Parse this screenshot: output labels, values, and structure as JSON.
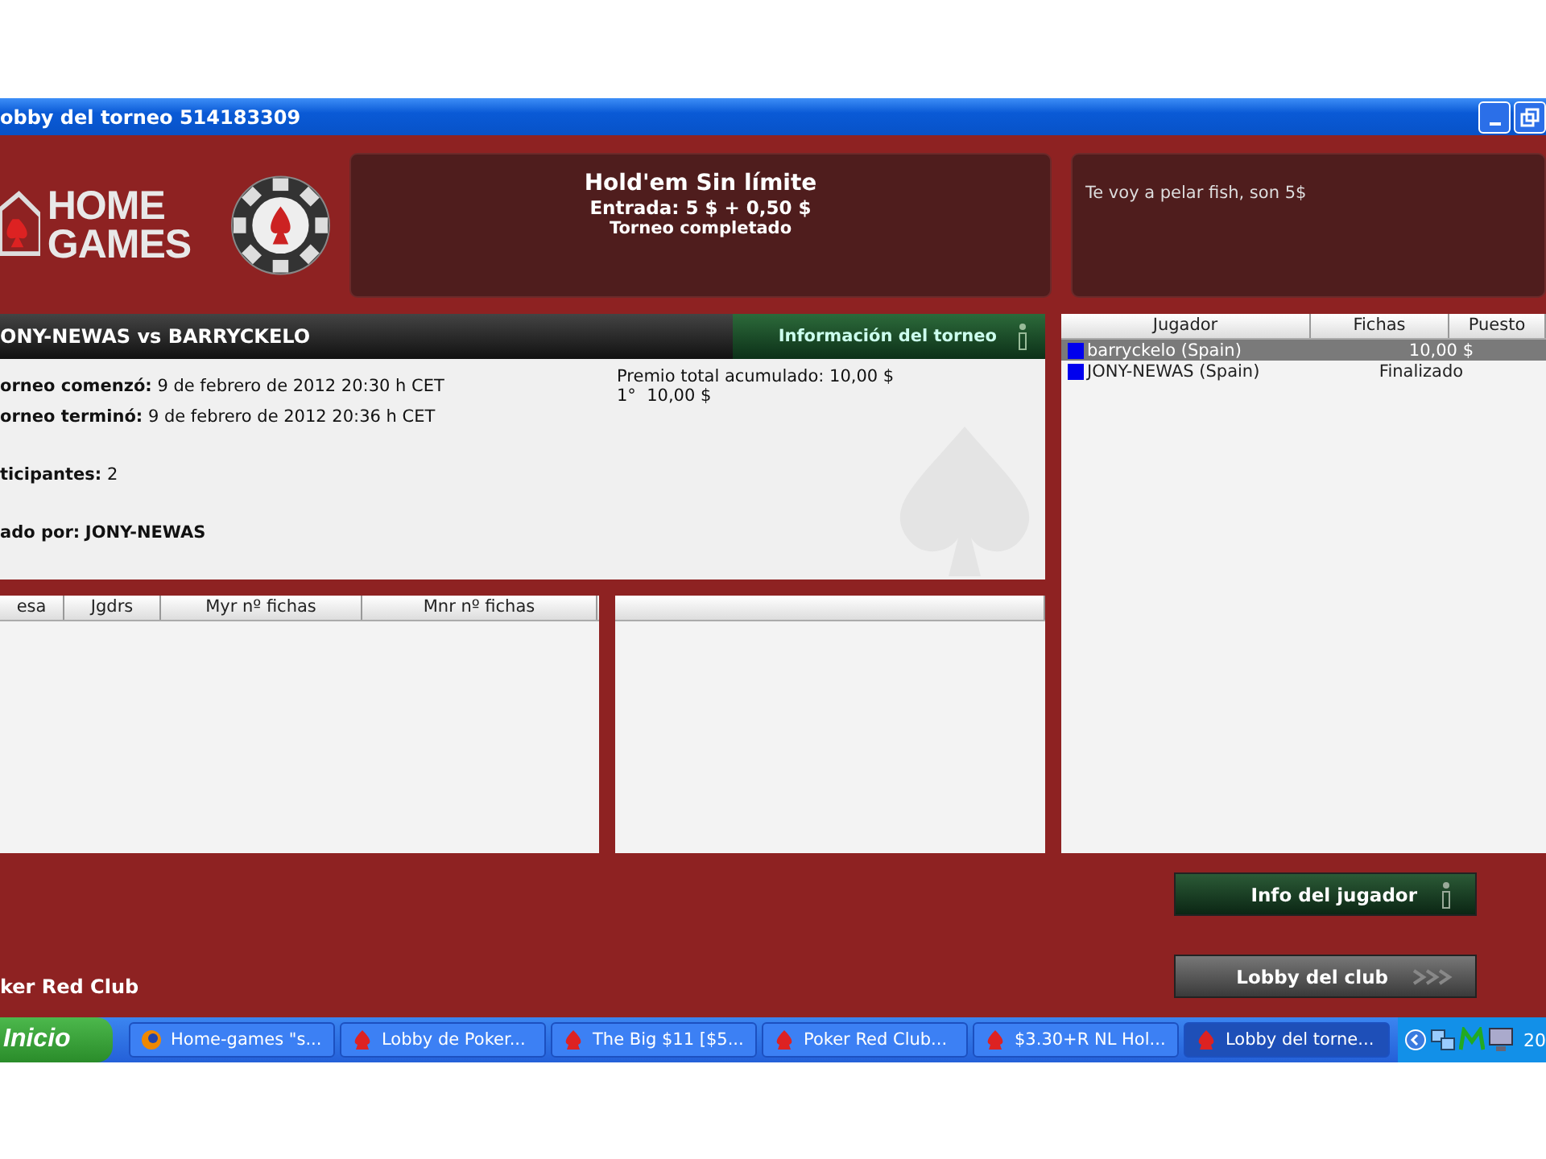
{
  "window": {
    "title": "obby del torneo 514183309"
  },
  "logo": {
    "line_1": "HOME",
    "line_2": "GAMES"
  },
  "game": {
    "name": "Hold'em Sin límite",
    "buyin": "Entrada: 5 $ + 0,50 $",
    "status": "Torneo completado"
  },
  "chat": {
    "message": "Te voy a pelar fish, son 5$"
  },
  "match": {
    "title": "ONY-NEWAS vs BARRYCKELO",
    "info_tab": "Información del torneo"
  },
  "details": [
    {
      "kind": "time",
      "label": "orneo comenzó:",
      "value": "9 de febrero de 2012 20:30 h CET"
    },
    {
      "kind": "time",
      "label": "orneo terminó:",
      "value": "9 de febrero de 2012 20:36 h CET"
    },
    {
      "kind": "count",
      "label": "ticipantes:",
      "value": "2"
    },
    {
      "kind": "host",
      "label": "ado por:",
      "value": "JONY-NEWAS"
    }
  ],
  "prize": {
    "total": "Premio total acumulado: 10,00 $",
    "places": [
      {
        "place": "1°",
        "amount": "10,00 $"
      }
    ]
  },
  "tables": {
    "columns": [
      "esa",
      "Jgdrs",
      "Myr nº fichas",
      "Mnr nº fichas"
    ]
  },
  "players": {
    "columns": [
      "Jugador",
      "Fichas",
      "Puesto"
    ],
    "rows": [
      {
        "name": "barryckelo (Spain)",
        "chips": "10,00 $",
        "selected": true,
        "color": "#0000ee"
      },
      {
        "name": "JONY-NEWAS (Spain)",
        "chips": "Finalizado",
        "selected": false,
        "color": "#0000ee"
      }
    ]
  },
  "club": {
    "name": "ker Red Club"
  },
  "buttons": [
    {
      "kind": "info",
      "label": "Info del jugador"
    },
    {
      "kind": "lobby",
      "label": "Lobby del club"
    }
  ],
  "taskbar": {
    "start": "Inicio",
    "tasks": [
      {
        "kind": "browser",
        "label": "Home-games \"s...",
        "selected": false
      },
      {
        "kind": "poker",
        "label": "Lobby de Poker...",
        "selected": false
      },
      {
        "kind": "poker",
        "label": "The Big $11 [$5...",
        "selected": false
      },
      {
        "kind": "poker",
        "label": "Poker Red Club...",
        "selected": false
      },
      {
        "kind": "poker",
        "label": "$3.30+R NL Hol...",
        "selected": false
      },
      {
        "kind": "poker",
        "label": "Lobby del torne...",
        "selected": true
      }
    ],
    "clock": "20"
  }
}
